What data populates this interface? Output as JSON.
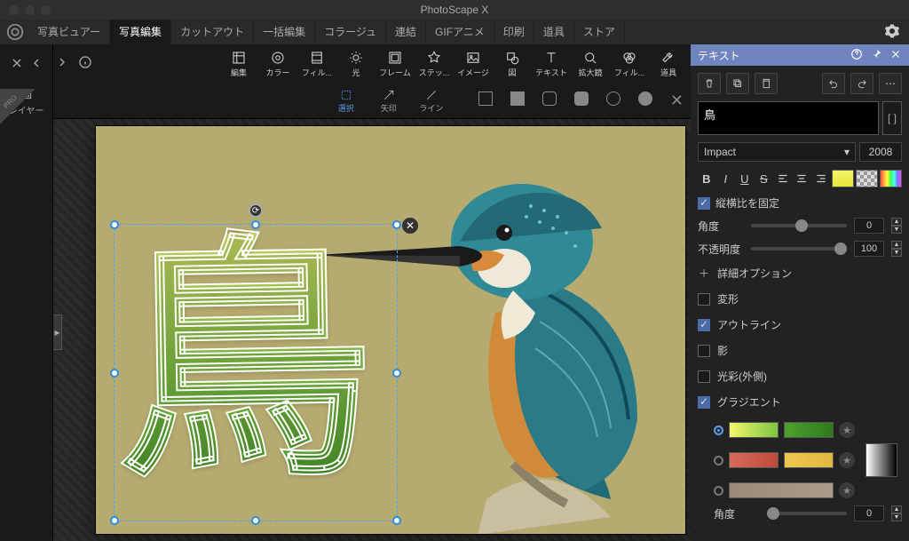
{
  "app": {
    "title": "PhotoScape X"
  },
  "tabs": [
    "写真ビュアー",
    "写真編集",
    "カットアウト",
    "一括編集",
    "コラージュ",
    "連結",
    "GIFアニメ",
    "印刷",
    "道具",
    "ストア"
  ],
  "activeTab": 1,
  "tools": [
    {
      "id": "edit",
      "label": "編集"
    },
    {
      "id": "color",
      "label": "カラー"
    },
    {
      "id": "film",
      "label": "フィル..."
    },
    {
      "id": "light",
      "label": "光"
    },
    {
      "id": "frame",
      "label": "フレーム"
    },
    {
      "id": "sticker",
      "label": "ステッ..."
    },
    {
      "id": "image",
      "label": "イメージ"
    },
    {
      "id": "shape",
      "label": "図"
    },
    {
      "id": "text",
      "label": "テキスト"
    },
    {
      "id": "magnifier",
      "label": "拡大鏡"
    },
    {
      "id": "filter",
      "label": "フィル..."
    },
    {
      "id": "tools",
      "label": "道具"
    }
  ],
  "subTools": {
    "select": "選択",
    "arrow": "矢印",
    "line": "ライン"
  },
  "layersLabel": "レイヤー",
  "proBadge": "PRO",
  "canvas": {
    "textValue": "鳥"
  },
  "panel": {
    "title": "テキスト",
    "textValue": "鳥",
    "bracket": "[ ]",
    "fontName": "Impact",
    "fontSize": "2008",
    "lockAspect": "縦横比を固定",
    "angleLabel": "角度",
    "angleValue": "0",
    "opacityLabel": "不透明度",
    "opacityValue": "100",
    "advanced": "詳細オプション",
    "transform": "変形",
    "outline": "アウトライン",
    "shadow": "影",
    "glow": "光彩(外側)",
    "gradient": "グラジエント",
    "gradAngleLabel": "角度",
    "gradAngleValue": "0"
  }
}
